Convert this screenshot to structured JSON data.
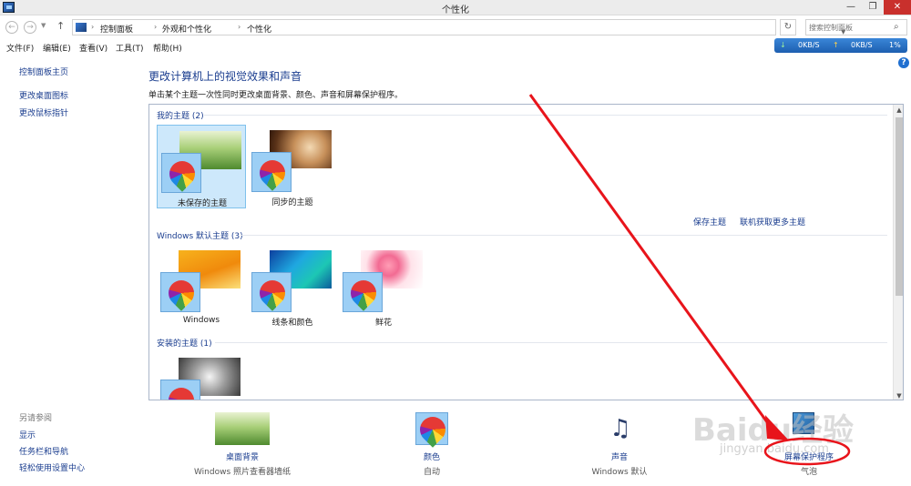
{
  "window": {
    "title": "个性化",
    "min": "—",
    "max": "❐",
    "close": "✕"
  },
  "nav": {
    "back": "←",
    "forward": "→",
    "up": "↑",
    "refresh": "↻",
    "search_placeholder": "搜索控制面板"
  },
  "breadcrumb": [
    "控制面板",
    "外观和个性化",
    "个性化"
  ],
  "menu": [
    "文件(F)",
    "编辑(E)",
    "查看(V)",
    "工具(T)",
    "帮助(H)"
  ],
  "netmon": {
    "down": "0KB/S",
    "up": "0KB/S",
    "percent": "1%"
  },
  "sidebar": {
    "links": [
      "控制面板主页",
      "更改桌面图标",
      "更改鼠标指针"
    ],
    "see_also_heading": "另请参阅",
    "see_also": [
      "显示",
      "任务栏和导航",
      "轻松使用设置中心"
    ]
  },
  "main": {
    "title": "更改计算机上的视觉效果和声音",
    "description": "单击某个主题一次性同时更改桌面背景、颜色、声音和屏幕保护程序。"
  },
  "groups": {
    "my": {
      "title": "我的主题 (2)",
      "themes": [
        "未保存的主题",
        "同步的主题"
      ]
    },
    "default": {
      "title": "Windows 默认主题 (3)",
      "themes": [
        "Windows",
        "线条和颜色",
        "鲜花"
      ]
    },
    "installed": {
      "title": "安装的主题 (1)"
    }
  },
  "links": {
    "save_theme": "保存主题",
    "get_more": "联机获取更多主题"
  },
  "bottom": [
    {
      "label": "桌面背景",
      "sub": "Windows 照片查看器墙纸"
    },
    {
      "label": "颜色",
      "sub": "自动"
    },
    {
      "label": "声音",
      "sub": "Windows 默认"
    },
    {
      "label": "屏幕保护程序",
      "sub": "气泡"
    }
  ],
  "watermark": {
    "main": "Baidu经验",
    "sub": "jingyan.baidu.com"
  },
  "colors": {
    "link": "#1a3d8f",
    "selected": "#cde8fb",
    "annotation": "#e8141b"
  }
}
